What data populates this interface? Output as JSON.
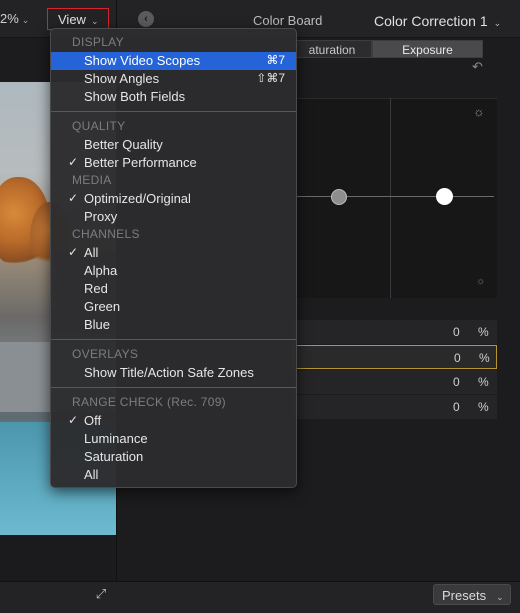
{
  "topbar": {
    "zoom_label": "2%",
    "view_label": "View",
    "board_title": "Color Board",
    "correction_label": "Color Correction 1"
  },
  "color_board": {
    "tabs": [
      "Saturation",
      "Exposure"
    ],
    "tab_saturation_visible": "aturation",
    "rows": [
      {
        "value": "0",
        "unit": "%"
      },
      {
        "value": "0",
        "unit": "%"
      },
      {
        "value": "0",
        "unit": "%"
      },
      {
        "value": "0",
        "unit": "%"
      }
    ]
  },
  "footer": {
    "presets_label": "Presets"
  },
  "menu": {
    "display_header": "DISPLAY",
    "show_video_scopes": "Show Video Scopes",
    "show_video_scopes_sc": "⌘7",
    "show_angles": "Show Angles",
    "show_angles_sc": "⇧⌘7",
    "show_both_fields": "Show Both Fields",
    "quality_header": "QUALITY",
    "better_quality": "Better Quality",
    "better_performance": "Better Performance",
    "media_header": "MEDIA",
    "optimized_original": "Optimized/Original",
    "proxy": "Proxy",
    "channels_header": "CHANNELS",
    "all_channels": "All",
    "alpha": "Alpha",
    "red": "Red",
    "green": "Green",
    "blue": "Blue",
    "overlays_header": "OVERLAYS",
    "safe_zones": "Show Title/Action Safe Zones",
    "range_header": "RANGE CHECK (Rec. 709)",
    "off": "Off",
    "luminance": "Luminance",
    "saturation": "Saturation",
    "all_range": "All",
    "checkmark": "✓"
  },
  "colors": {
    "accent": "#2563d8",
    "highlight_border": "#b9962d",
    "view_outline": "#d8232a"
  }
}
